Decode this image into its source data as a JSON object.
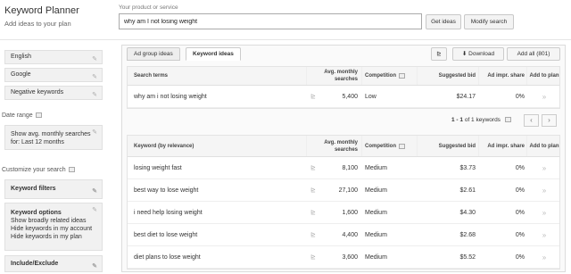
{
  "header": {
    "app_title": "Keyword Planner",
    "app_subtitle": "Add ideas to your plan",
    "search_label": "Your product or service",
    "search_value": "why am I not losing weight",
    "get_ideas": "Get ideas",
    "modify_search": "Modify search"
  },
  "sidebar": {
    "language": "English",
    "network": "Google",
    "negative_keywords": "Negative keywords",
    "date_range_heading": "Date range",
    "date_range_value": "Show avg. monthly searches for: Last 12 months",
    "customize_heading": "Customize your search",
    "keyword_filters": "Keyword filters",
    "keyword_options_title": "Keyword options",
    "keyword_options_lines": [
      "Show broadly related ideas",
      "Hide keywords in my account",
      "Hide keywords in my plan"
    ],
    "include_exclude": "Include/Exclude"
  },
  "tabs": {
    "ad_group_ideas": "Ad group ideas",
    "keyword_ideas": "Keyword ideas"
  },
  "toolbar": {
    "chart_icon": "chart-icon",
    "download": "Download",
    "add_all": "Add all (801)"
  },
  "search_terms_table": {
    "col_term": "Search terms",
    "col_searches_1": "Avg. monthly",
    "col_searches_2": "searches",
    "col_competition": "Competition",
    "col_bid_1": "Suggested bid",
    "col_share_1": "Ad impr. share",
    "col_add": "Add to plan",
    "rows": [
      {
        "term": "why am i not losing weight",
        "searches": "5,400",
        "competition": "Low",
        "bid": "$24.17",
        "share": "0%",
        "add": "»"
      }
    ]
  },
  "paging": {
    "text_prefix": "1 - 1",
    "text_suffix": "of 1 keywords"
  },
  "ideas_table": {
    "col_term": "Keyword (by relevance)",
    "col_searches_1": "Avg. monthly",
    "col_searches_2": "searches",
    "col_competition": "Competition",
    "col_bid_1": "Suggested bid",
    "col_share_1": "Ad impr. share",
    "col_add": "Add to plan",
    "rows": [
      {
        "term": "losing weight fast",
        "searches": "8,100",
        "competition": "Medium",
        "bid": "$3.73",
        "share": "0%",
        "add": "»"
      },
      {
        "term": "best way to lose weight",
        "searches": "27,100",
        "competition": "Medium",
        "bid": "$2.61",
        "share": "0%",
        "add": "»"
      },
      {
        "term": "i need help losing weight",
        "searches": "1,600",
        "competition": "Medium",
        "bid": "$4.30",
        "share": "0%",
        "add": "»"
      },
      {
        "term": "best diet to lose weight",
        "searches": "4,400",
        "competition": "Medium",
        "bid": "$2.68",
        "share": "0%",
        "add": "»"
      },
      {
        "term": "diet plans to lose weight",
        "searches": "3,600",
        "competition": "Medium",
        "bid": "$5.52",
        "share": "0%",
        "add": "»"
      }
    ]
  }
}
